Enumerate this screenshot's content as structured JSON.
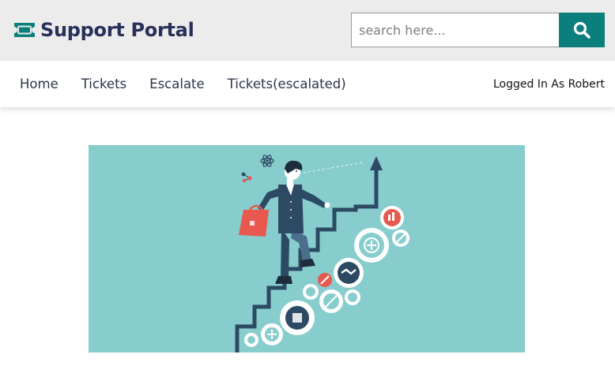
{
  "header": {
    "brand_title": "Support Portal",
    "brand_icon": "ticket-icon",
    "search": {
      "placeholder": "search here...",
      "value": "",
      "button_icon": "search-icon"
    }
  },
  "nav": {
    "items": [
      {
        "label": "Home"
      },
      {
        "label": "Tickets"
      },
      {
        "label": "Escalate"
      },
      {
        "label": "Tickets(escalated)"
      }
    ],
    "user_status": "Logged In As Robert"
  },
  "hero": {
    "image": "businessman-climbing-stairs-gears-illustration"
  },
  "colors": {
    "header_bg": "#ececec",
    "brand_text": "#28305a",
    "brand_icon": "#0b7f7c",
    "search_button": "#0b7f7c",
    "hero_bg": "#88cdcd",
    "stair_line": "#2c4a63",
    "accent_red": "#e8584f"
  }
}
